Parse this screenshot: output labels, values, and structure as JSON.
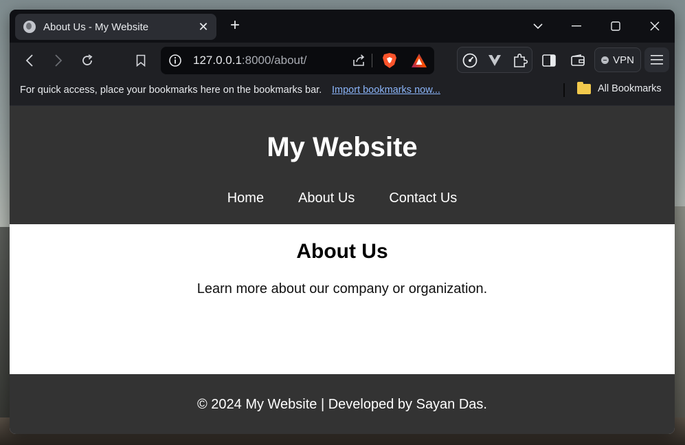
{
  "browser": {
    "tab": {
      "title": "About Us - My Website",
      "favicon": "globe-icon"
    },
    "new_tab_label": "+",
    "url": {
      "host": "127.0.0.1",
      "rest": ":8000/about/"
    },
    "vpn_label": "VPN",
    "bookmarks_bar": {
      "message": "For quick access, place your bookmarks here on the bookmarks bar.",
      "import_link": "Import bookmarks now...",
      "all_bookmarks": "All Bookmarks"
    }
  },
  "site": {
    "title": "My Website",
    "nav": [
      "Home",
      "About Us",
      "Contact Us"
    ],
    "heading": "About Us",
    "description": "Learn more about our company or organization.",
    "footer": "© 2024 My Website | Developed by Sayan Das."
  },
  "colors": {
    "header_bg": "#333333",
    "footer_bg": "#333333",
    "link_color": "#8ab4f8",
    "folder": "#f2c94c"
  }
}
